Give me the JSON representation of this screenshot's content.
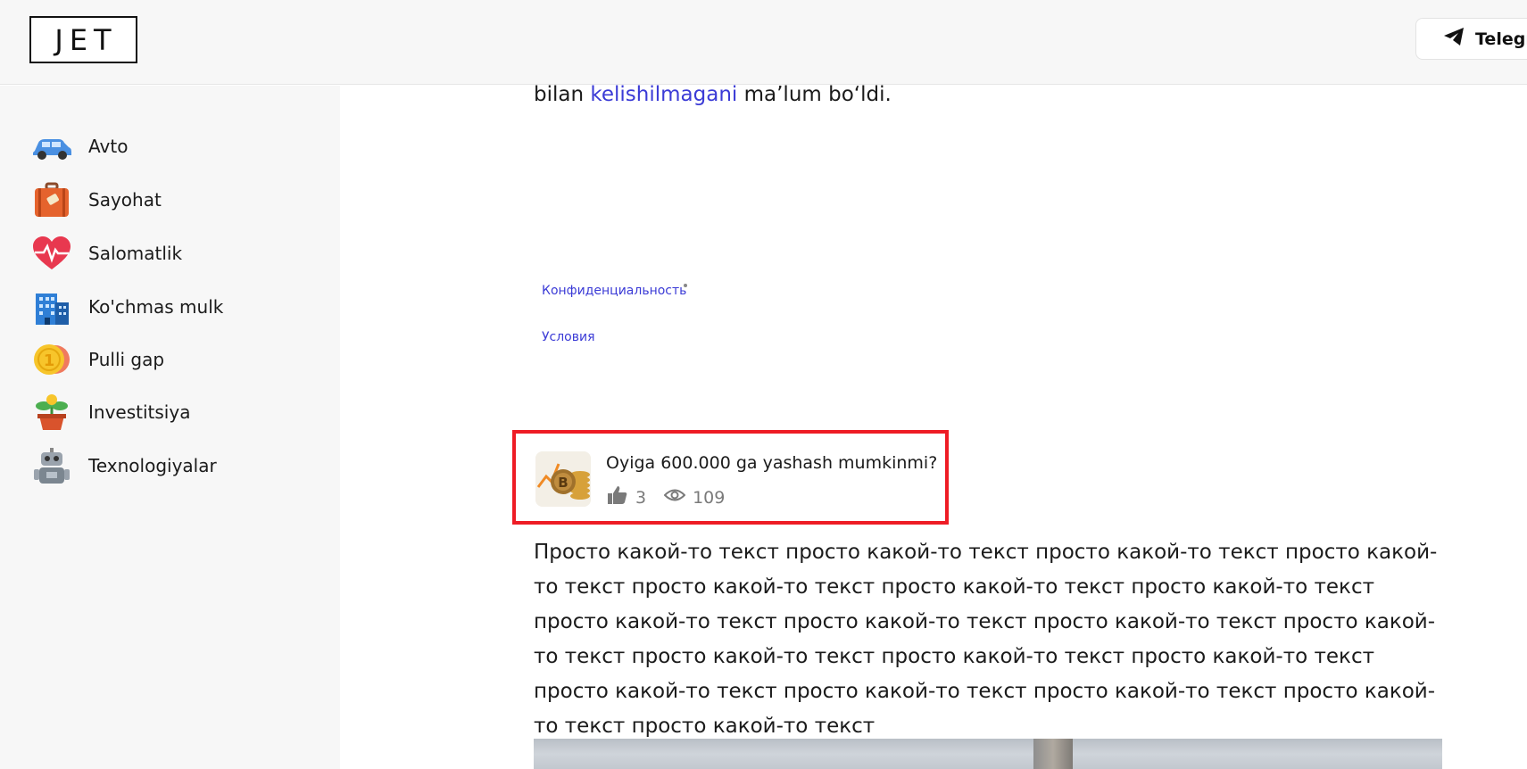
{
  "header": {
    "logo_text": "JET",
    "telegram_label": "Telegr"
  },
  "sidebar": {
    "items": [
      {
        "label": "Avto",
        "icon": "car-icon"
      },
      {
        "label": "Sayohat",
        "icon": "suitcase-icon"
      },
      {
        "label": "Salomatlik",
        "icon": "heart-pulse-icon"
      },
      {
        "label": "Ko'chmas mulk",
        "icon": "building-icon"
      },
      {
        "label": "Pulli gap",
        "icon": "coin-icon"
      },
      {
        "label": "Investitsiya",
        "icon": "plant-pot-icon"
      },
      {
        "label": "Texnologiyalar",
        "icon": "robot-icon"
      }
    ]
  },
  "article": {
    "prev_text_start": "bilan ",
    "prev_link": "kelishilmagani",
    "prev_text_end": " ma’lum bo‘ldi.",
    "footer_links": {
      "privacy": "Конфиденциальность",
      "terms": "Условия"
    },
    "related_card": {
      "title": "Oyiga 600.000 ga yashash mumkinmi?",
      "likes": "3",
      "views": "109"
    },
    "body": "Просто какой-то текст просто какой-то текст просто какой-то текст просто какой-то текст просто какой-то текст просто какой-то текст просто какой-то текст просто какой-то текст просто какой-то текст просто какой-то текст просто какой-то текст просто какой-то текст просто какой-то текст просто какой-то текст просто какой-то текст просто какой-то текст просто какой-то текст просто какой-то текст просто какой-то текст"
  },
  "colors": {
    "link": "#3b3bd6",
    "highlight_border": "#ee1c25",
    "sidebar_bg": "#f7f7f7"
  }
}
